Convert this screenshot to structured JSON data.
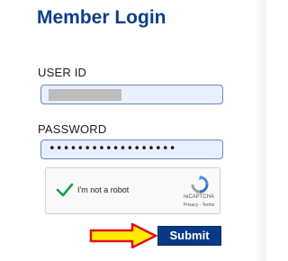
{
  "header": {
    "title": "Member Login"
  },
  "form": {
    "user_id_label": "USER ID",
    "password_label": "PASSWORD",
    "password_masked": "••••••••••••••••••",
    "submit_label": "Submit"
  },
  "recaptcha": {
    "label": "I'm not a robot",
    "brand": "reCAPTCHA",
    "links": "Privacy - Terms"
  },
  "colors": {
    "brand_blue": "#0a3f88",
    "button_bg": "#0a3a86",
    "input_bg": "#e8f0fe",
    "input_border": "#6d86be",
    "check_green": "#1e9e4a",
    "arrow_yellow": "#ffec00",
    "arrow_red": "#e0121a"
  },
  "icons": {
    "checkmark": "checkmark-icon",
    "recaptcha_logo": "recaptcha-logo-icon",
    "pointer_arrow": "arrow-right-icon"
  }
}
